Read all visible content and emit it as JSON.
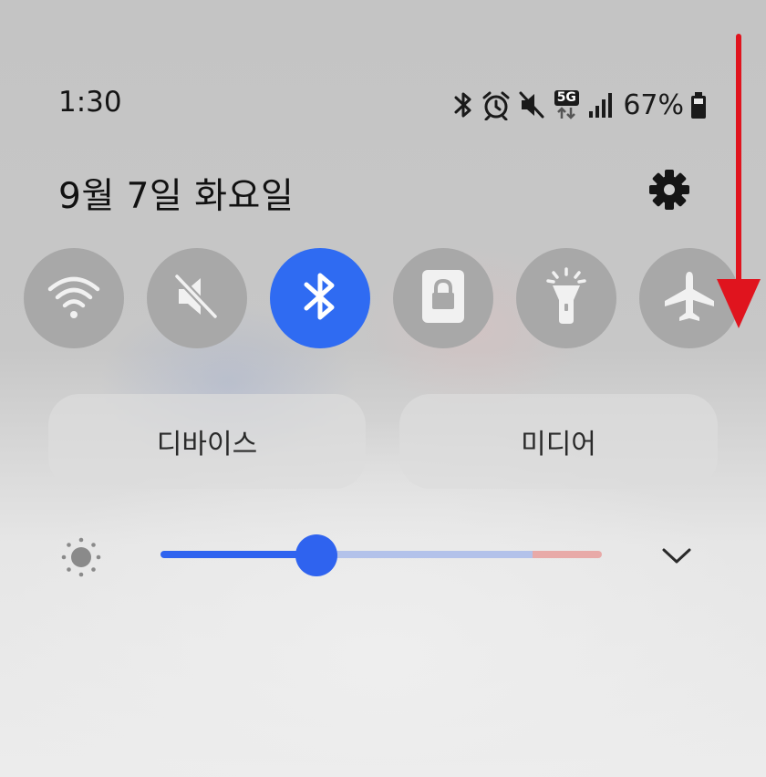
{
  "status_bar": {
    "time": "1:30",
    "icons": [
      "bluetooth-icon",
      "alarm-icon",
      "mute-icon",
      "5g-data-icon",
      "signal-icon",
      "battery-icon"
    ],
    "network_badge": "5G",
    "battery_percent": "67%"
  },
  "header": {
    "date": "9월 7일 화요일",
    "settings_icon": "gear-icon"
  },
  "quick_settings": {
    "tiles": [
      {
        "name": "wifi",
        "icon": "wifi-icon",
        "active": false
      },
      {
        "name": "sound",
        "icon": "mute-icon",
        "active": false
      },
      {
        "name": "bluetooth",
        "icon": "bluetooth-icon",
        "active": true
      },
      {
        "name": "screen-lock",
        "icon": "lock-icon",
        "active": false
      },
      {
        "name": "flashlight",
        "icon": "flashlight-icon",
        "active": false
      },
      {
        "name": "airplane",
        "icon": "airplane-icon",
        "active": false
      }
    ],
    "active_color": "#2f6bf2",
    "inactive_color": "#a8a8a8"
  },
  "panels": {
    "devices_label": "디바이스",
    "media_label": "미디어"
  },
  "brightness": {
    "level": 0.35,
    "icon": "sun-icon",
    "expand_icon": "chevron-down-icon"
  },
  "annotation": {
    "type": "swipe-down-arrow",
    "color": "#e0141e"
  }
}
